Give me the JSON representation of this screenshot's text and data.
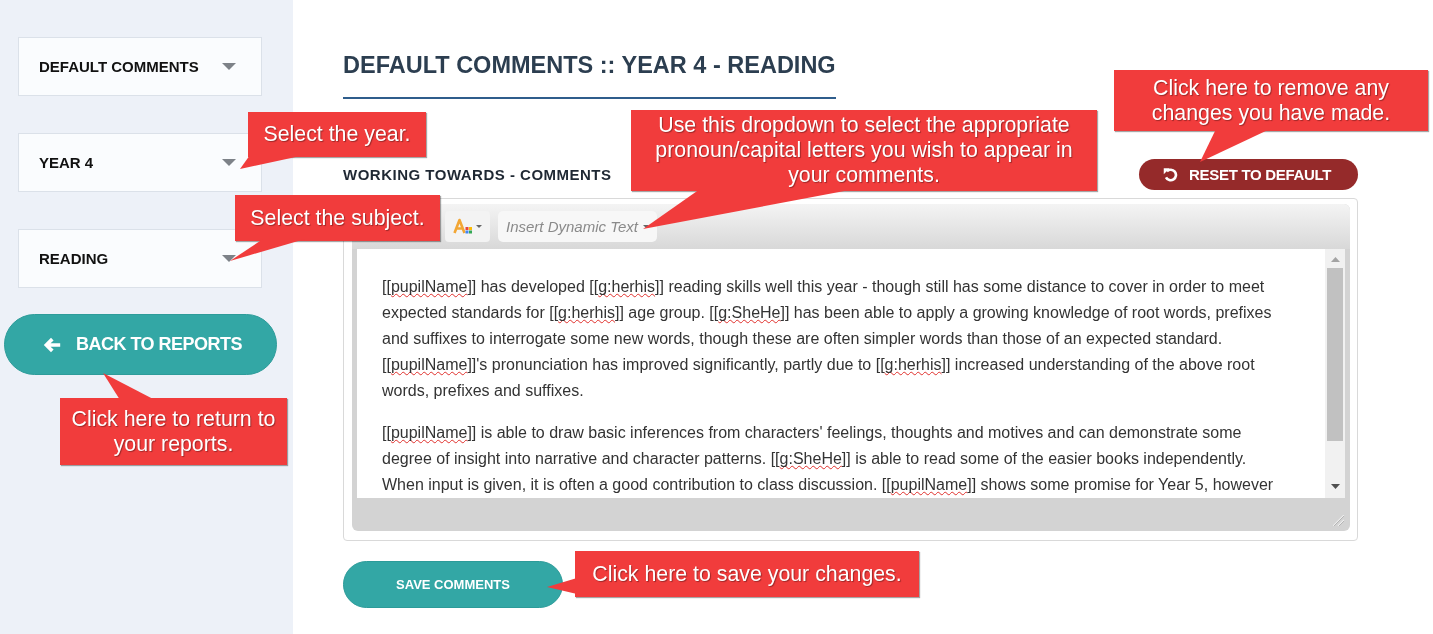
{
  "sidebar": {
    "dropdowns": [
      {
        "label": "DEFAULT COMMENTS"
      },
      {
        "label": "YEAR 4"
      },
      {
        "label": "READING"
      }
    ],
    "back_button": {
      "label": "BACK TO REPORTS"
    }
  },
  "main": {
    "title": "DEFAULT COMMENTS :: YEAR 4 - READING",
    "section_label": "WORKING TOWARDS - COMMENTS",
    "reset_button": {
      "label": "RESET TO DEFAULT"
    },
    "editor": {
      "dynamic_text_dropdown": {
        "label": "Insert Dynamic Text"
      },
      "paragraphs": [
        {
          "segments": [
            {
              "text": "[[",
              "misspelled": false
            },
            {
              "text": "pupilName",
              "misspelled": true
            },
            {
              "text": "]] has developed [[",
              "misspelled": false
            },
            {
              "text": "g:herhis",
              "misspelled": true
            },
            {
              "text": "]] reading skills well this year - though still has some distance to cover in order to meet expected standards for [[",
              "misspelled": false
            },
            {
              "text": "g:herhis",
              "misspelled": true
            },
            {
              "text": "]] age group. [[",
              "misspelled": false
            },
            {
              "text": "g:SheHe",
              "misspelled": true
            },
            {
              "text": "]] has been able to apply a growing knowledge of root words, prefixes and suffixes to interrogate some new words, though these are often simpler words than those of an expected standard. [[",
              "misspelled": false
            },
            {
              "text": "pupilName",
              "misspelled": true
            },
            {
              "text": "]]'s pronunciation has improved significantly, partly due to [[",
              "misspelled": false
            },
            {
              "text": "g:herhis",
              "misspelled": true
            },
            {
              "text": "]] increased understanding of the above root words, prefixes and suffixes.",
              "misspelled": false
            }
          ]
        },
        {
          "segments": [
            {
              "text": "[[",
              "misspelled": false
            },
            {
              "text": "pupilName",
              "misspelled": true
            },
            {
              "text": "]] is able to draw basic inferences from characters' feelings, thoughts and motives and can demonstrate some degree of insight into narrative and character patterns. [[",
              "misspelled": false
            },
            {
              "text": "g:SheHe",
              "misspelled": true
            },
            {
              "text": "]] is able to read some of the easier books independently. When input is given, it is often a good contribution to class discussion. [[",
              "misspelled": false
            },
            {
              "text": "pupilName",
              "misspelled": true
            },
            {
              "text": "]] shows some promise for Year 5, however",
              "misspelled": false
            }
          ]
        }
      ]
    },
    "save_button": {
      "label": "SAVE COMMENTS"
    }
  },
  "callouts": [
    {
      "text": "Select the year."
    },
    {
      "text": "Use this dropdown to select the appropriate pronoun/capital letters you wish to appear in your comments."
    },
    {
      "text": "Click here to remove any changes you have made."
    },
    {
      "text": "Select the subject."
    },
    {
      "text": "Click here to return to your reports."
    },
    {
      "text": "Click here to save your changes."
    }
  ]
}
